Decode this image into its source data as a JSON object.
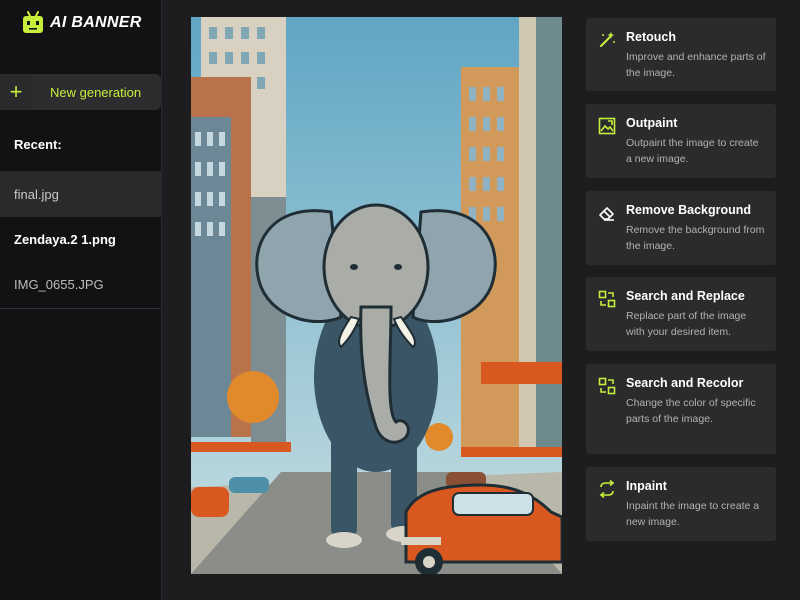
{
  "app": {
    "name": "AI BANNER",
    "accent_color": "#c6ee3a"
  },
  "sidebar": {
    "new_generation_label": "New generation",
    "new_generation_icon": "plus-icon",
    "recent_heading": "Recent:",
    "recent_items": [
      {
        "label": "final.jpg",
        "active": true
      },
      {
        "label": "Zendaya.2 1.png",
        "active": false
      },
      {
        "label": "IMG_0655.JPG",
        "active": false
      }
    ]
  },
  "tools": [
    {
      "icon": "magic-wand-icon",
      "title": "Retouch",
      "description": "Improve and enhance parts of the image."
    },
    {
      "icon": "outpaint-icon",
      "title": "Outpaint",
      "description": "Outpaint the image to create a new image."
    },
    {
      "icon": "eraser-icon",
      "title": "Remove Background",
      "description": "Remove the background from the image."
    },
    {
      "icon": "replace-icon",
      "title": "Search and Replace",
      "description": "Replace part of the image with your desired item."
    },
    {
      "icon": "recolor-icon",
      "title": "Search and Recolor",
      "description": "Change the color of specific parts of the image."
    },
    {
      "icon": "swap-icon",
      "title": "Inpaint",
      "description": "Inpaint the image to create a new image."
    }
  ]
}
